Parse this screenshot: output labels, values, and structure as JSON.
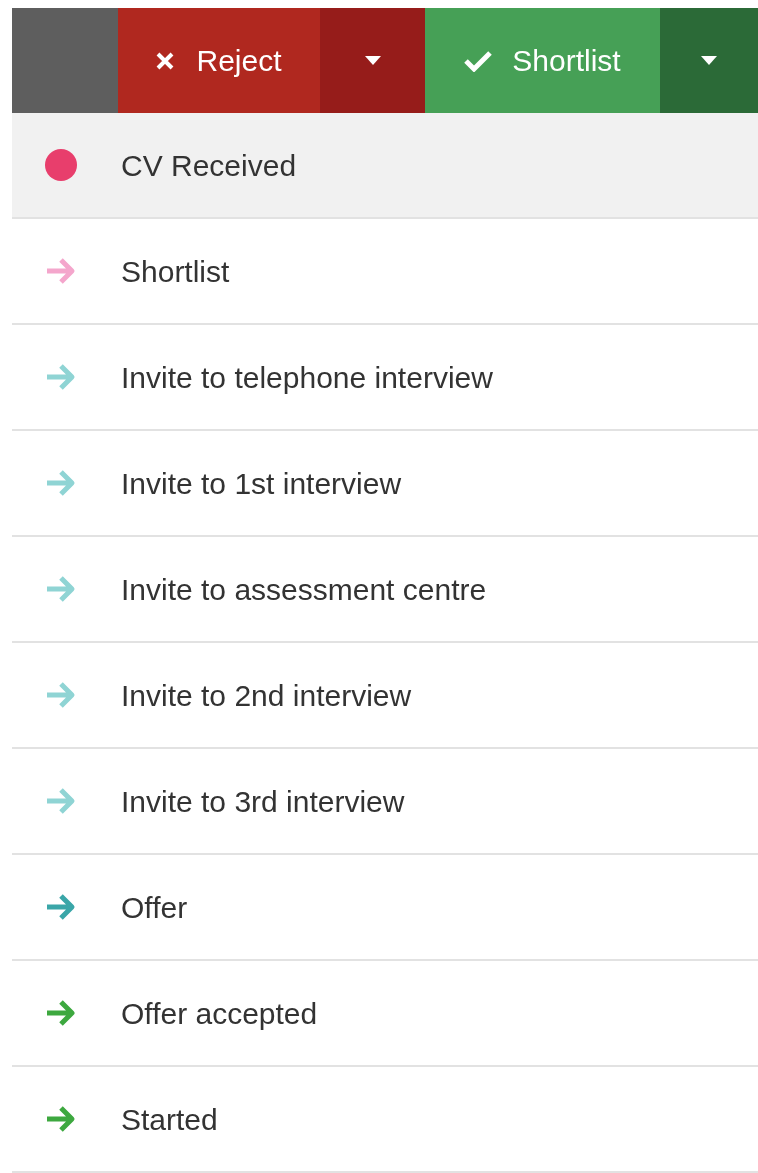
{
  "toolbar": {
    "reject": {
      "label": "Reject"
    },
    "shortlist": {
      "label": "Shortlist"
    }
  },
  "stages": [
    {
      "label": "CV Received",
      "kind": "dot",
      "color": "#e83e6c",
      "selected": true
    },
    {
      "label": "Shortlist",
      "kind": "arrow",
      "color": "#f4a6cc",
      "selected": false
    },
    {
      "label": "Invite to telephone interview",
      "kind": "arrow",
      "color": "#8fd4d4",
      "selected": false
    },
    {
      "label": "Invite to 1st interview",
      "kind": "arrow",
      "color": "#8fd4d4",
      "selected": false
    },
    {
      "label": "Invite to assessment centre",
      "kind": "arrow",
      "color": "#8fd4d4",
      "selected": false
    },
    {
      "label": "Invite to 2nd interview",
      "kind": "arrow",
      "color": "#8fd4d4",
      "selected": false
    },
    {
      "label": "Invite to 3rd interview",
      "kind": "arrow",
      "color": "#8fd4d4",
      "selected": false
    },
    {
      "label": "Offer",
      "kind": "arrow",
      "color": "#3aa6a8",
      "selected": false
    },
    {
      "label": "Offer accepted",
      "kind": "arrow",
      "color": "#3da83f",
      "selected": false
    },
    {
      "label": "Started",
      "kind": "arrow",
      "color": "#3da83f",
      "selected": false
    }
  ]
}
